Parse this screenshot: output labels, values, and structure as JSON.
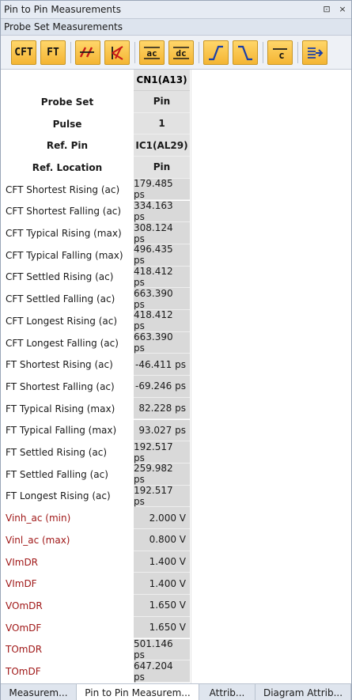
{
  "window": {
    "title": "Pin to Pin Measurements",
    "pin_glyph": "⊡",
    "close_glyph": "×"
  },
  "section": {
    "title": "Probe Set Measurements"
  },
  "toolbar": {
    "cft_label": "CFT",
    "ft_label": "FT",
    "ac_label": "ac",
    "dc_label": "dc",
    "c_label": "c",
    "accent": "#f4b533"
  },
  "grid": {
    "column_header": "CN1(A13)",
    "header_rows": [
      {
        "label": "Probe Set",
        "value": "Pin"
      },
      {
        "label": "Pulse",
        "value": "1"
      },
      {
        "label": "Ref. Pin",
        "value": "IC1(AL29)"
      },
      {
        "label": "Ref. Location",
        "value": "Pin"
      }
    ],
    "rows": [
      {
        "label": "CFT Shortest Rising (ac)",
        "value": "179.485 ps",
        "red": false
      },
      {
        "label": "CFT Shortest Falling (ac)",
        "value": "334.163 ps",
        "red": false
      },
      {
        "label": "CFT Typical Rising (max)",
        "value": "308.124 ps",
        "red": false
      },
      {
        "label": "CFT Typical Falling (max)",
        "value": "496.435 ps",
        "red": false
      },
      {
        "label": "CFT Settled Rising (ac)",
        "value": "418.412 ps",
        "red": false
      },
      {
        "label": "CFT Settled Falling (ac)",
        "value": "663.390 ps",
        "red": false
      },
      {
        "label": "CFT Longest Rising (ac)",
        "value": "418.412 ps",
        "red": false
      },
      {
        "label": "CFT Longest Falling (ac)",
        "value": "663.390 ps",
        "red": false
      },
      {
        "label": "FT Shortest Rising (ac)",
        "value": "-46.411 ps",
        "red": false
      },
      {
        "label": "FT Shortest Falling (ac)",
        "value": "-69.246 ps",
        "red": false
      },
      {
        "label": "FT Typical Rising (max)",
        "value": "82.228 ps",
        "red": false
      },
      {
        "label": "FT Typical Falling (max)",
        "value": "93.027 ps",
        "red": false
      },
      {
        "label": "FT Settled Rising (ac)",
        "value": "192.517 ps",
        "red": false
      },
      {
        "label": "FT Settled Falling (ac)",
        "value": "259.982 ps",
        "red": false
      },
      {
        "label": "FT Longest Rising (ac)",
        "value": "192.517 ps",
        "red": false
      },
      {
        "label": "Vinh_ac (min)",
        "value": "2.000 V",
        "red": true
      },
      {
        "label": "Vinl_ac (max)",
        "value": "0.800 V",
        "red": true
      },
      {
        "label": "VImDR",
        "value": "1.400 V",
        "red": true
      },
      {
        "label": "VImDF",
        "value": "1.400 V",
        "red": true
      },
      {
        "label": "VOmDR",
        "value": "1.650 V",
        "red": true
      },
      {
        "label": "VOmDF",
        "value": "1.650 V",
        "red": true
      },
      {
        "label": "TOmDR",
        "value": "501.146 ps",
        "red": true
      },
      {
        "label": "TOmDF",
        "value": "647.204 ps",
        "red": true
      }
    ]
  },
  "tabs": [
    {
      "label": "Measurem...",
      "active": false
    },
    {
      "label": "Pin to Pin Measurem...",
      "active": true
    },
    {
      "label": "Attrib...",
      "active": false
    },
    {
      "label": "Diagram Attrib...",
      "active": false
    }
  ]
}
